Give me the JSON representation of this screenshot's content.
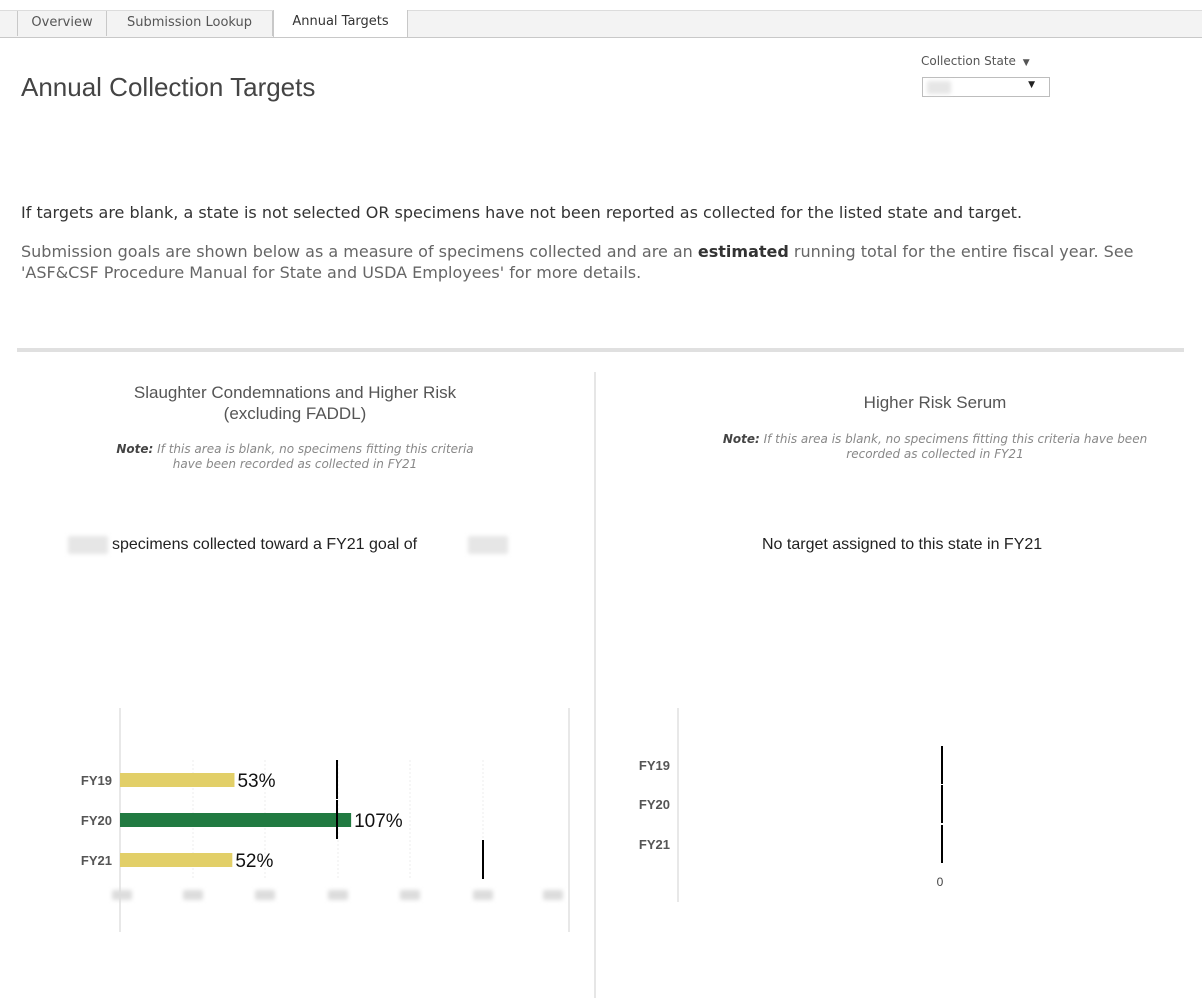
{
  "tabs": [
    {
      "label": "Overview",
      "active": false
    },
    {
      "label": "Submission Lookup",
      "active": false
    },
    {
      "label": "Annual Targets",
      "active": true
    }
  ],
  "page_title": "Annual Collection Targets",
  "filter": {
    "label": "Collection State",
    "value": ""
  },
  "notice": "If targets are blank, a state is not selected OR specimens have not been reported as collected for the listed state and target.",
  "description": {
    "before": "Submission goals are shown below as a measure of specimens collected and are an ",
    "bold": "estimated",
    "after": " running total for the entire fiscal year. See 'ASF&CSF Procedure Manual for State and USDA Employees' for more details."
  },
  "left_panel": {
    "title_line1": "Slaughter Condemnations and Higher Risk",
    "title_line2": "(excluding FADDL)",
    "note_bold": "Note:",
    "note_line1": " If this area is blank, no specimens fitting this criteria",
    "note_line2": "have been recorded as collected in FY21",
    "stat_mid": "specimens collected toward a FY21 goal of"
  },
  "right_panel": {
    "title": "Higher Risk Serum",
    "note_bold": "Note:",
    "note_line1": " If this area is blank, no specimens fitting this criteria have been",
    "note_line2": "recorded as collected in FY21",
    "stat": "No target assigned to this state in FY21"
  },
  "colors": {
    "below_target": "#e2cf68",
    "above_target": "#217a41",
    "target_marker": "#000000"
  },
  "chart_data": [
    {
      "type": "bar",
      "orientation": "horizontal",
      "categories": [
        "FY19",
        "FY20",
        "FY21"
      ],
      "values": [
        0.53,
        1.07,
        0.52
      ],
      "data_labels": [
        "53%",
        "107%",
        "52%"
      ],
      "bar_colors": [
        "#e2cf68",
        "#217a41",
        "#e2cf68"
      ],
      "target_markers": true,
      "x_tick_labels_obscured": true,
      "grid": true
    },
    {
      "type": "bar",
      "orientation": "horizontal",
      "categories": [
        "FY19",
        "FY20",
        "FY21"
      ],
      "values": [
        0,
        0,
        0
      ],
      "target_markers": true,
      "x_tick_labels": [
        "0"
      ],
      "grid": false
    }
  ]
}
